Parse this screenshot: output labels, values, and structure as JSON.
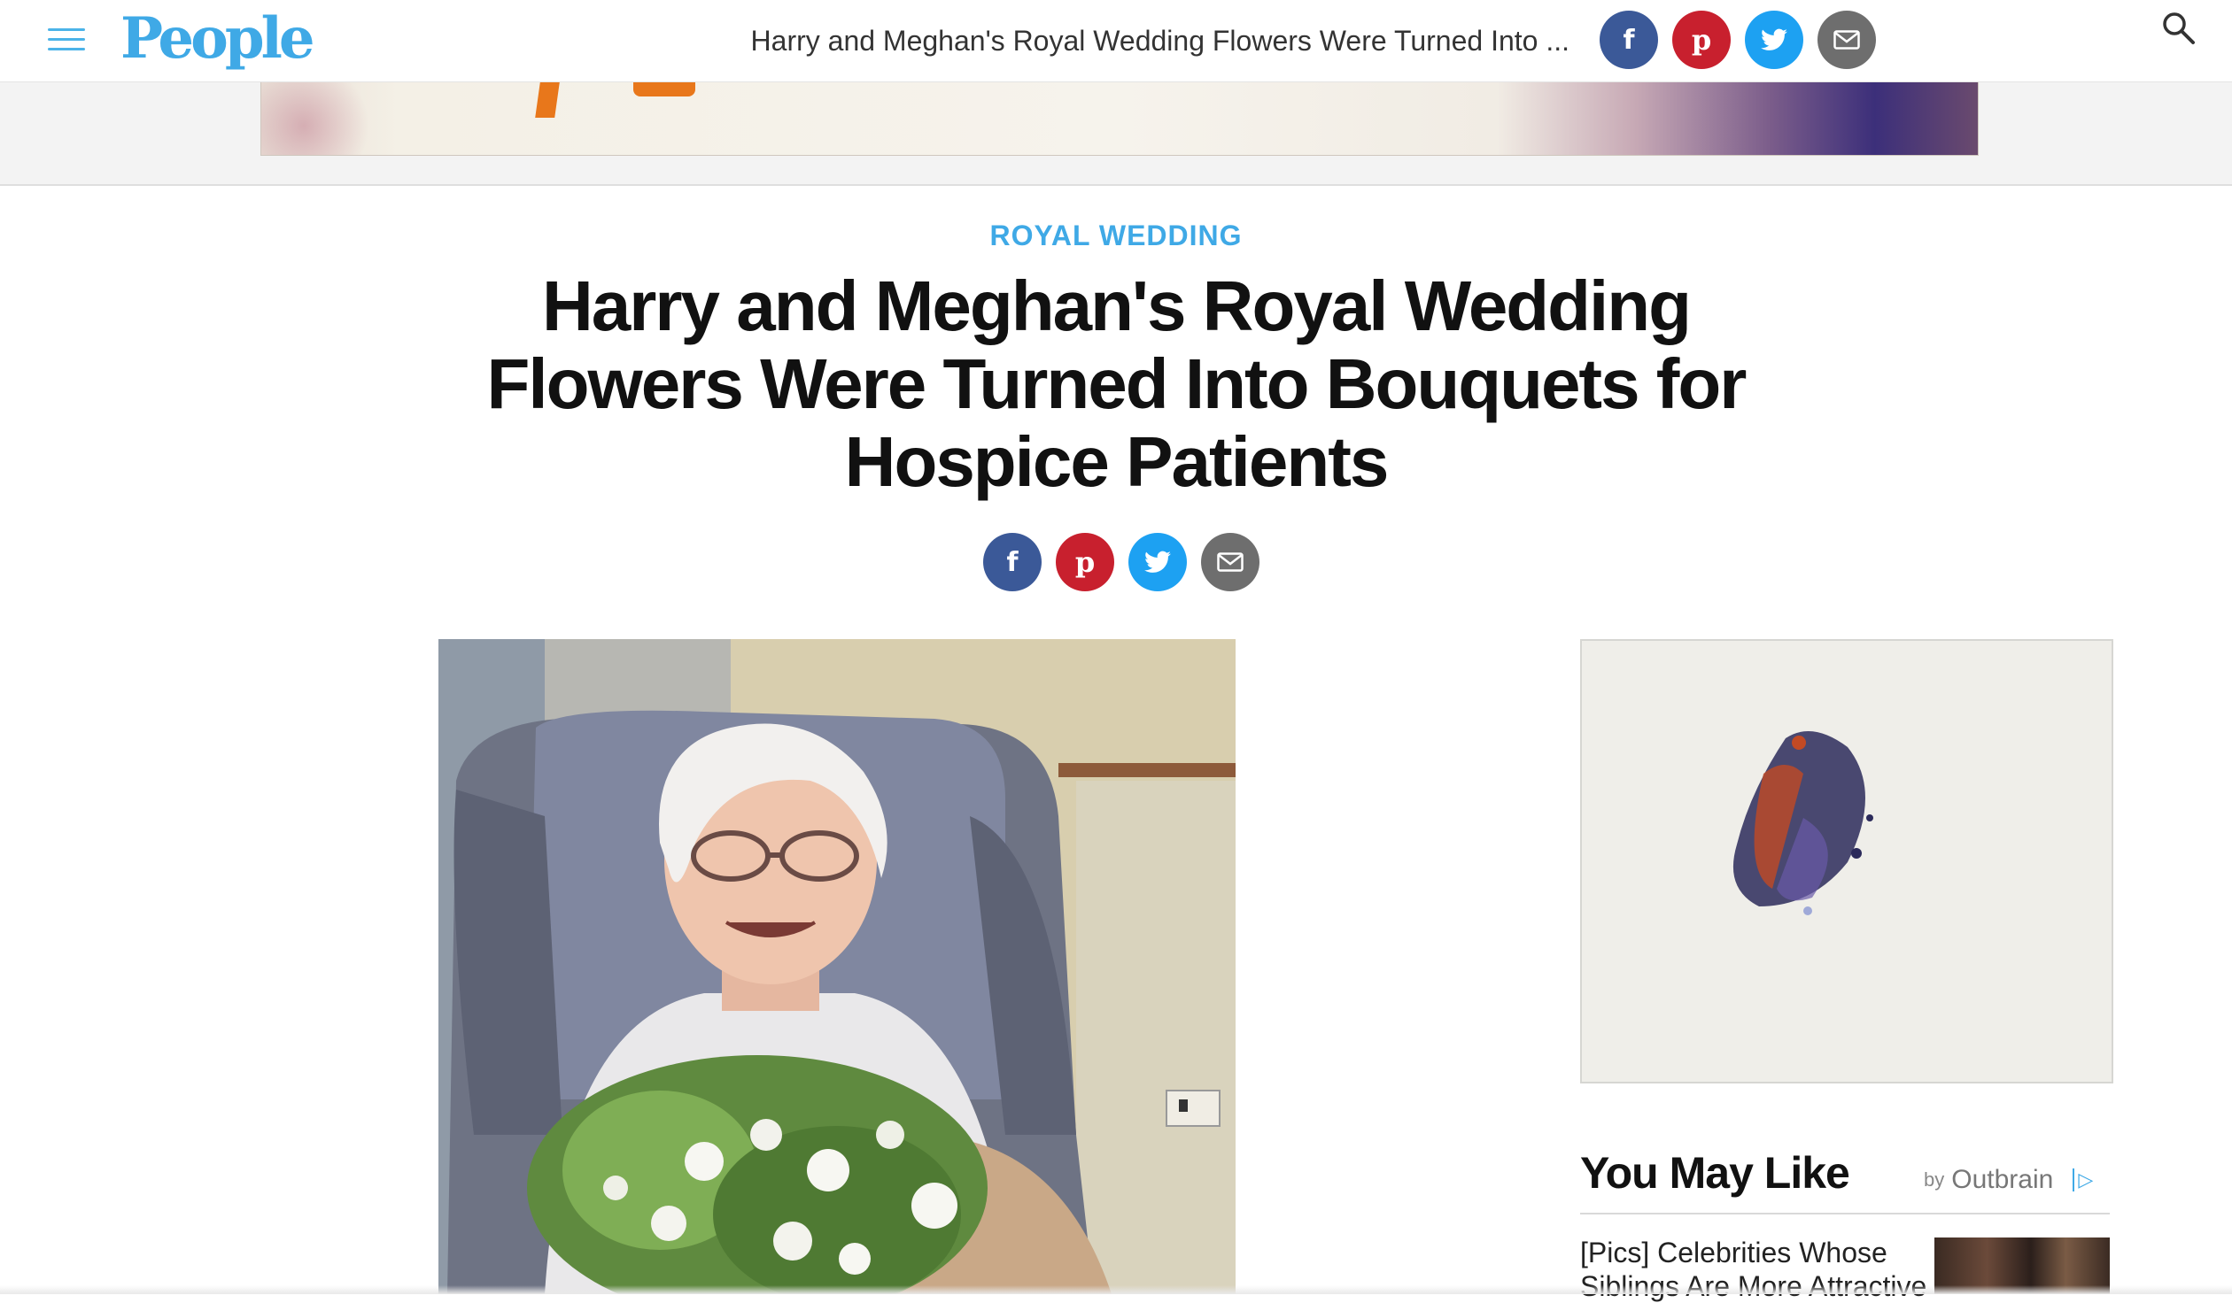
{
  "header": {
    "logo_text": "People",
    "article_title_truncated": "Harry and Meghan's Royal Wedding Flowers Were Turned Into ...",
    "share_icons": [
      "facebook-icon",
      "pinterest-icon",
      "twitter-icon",
      "email-icon"
    ]
  },
  "article": {
    "category": "ROYAL WEDDING",
    "headline_lines": [
      "Harry and Meghan's Royal Wedding",
      "Flowers Were Turned Into Bouquets for",
      "Hospice Patients"
    ]
  },
  "sidebar": {
    "you_may_like": {
      "title": "You May Like",
      "by_label": "by",
      "provider": "Outbrain",
      "items": [
        {
          "text": "[Pics] Celebrities Whose Siblings Are More Attractive"
        }
      ]
    }
  },
  "colors": {
    "brand_blue": "#3fa9e6",
    "facebook": "#3b5998",
    "pinterest": "#c8202e",
    "twitter": "#1da1f2",
    "email": "#6e6e6e"
  }
}
